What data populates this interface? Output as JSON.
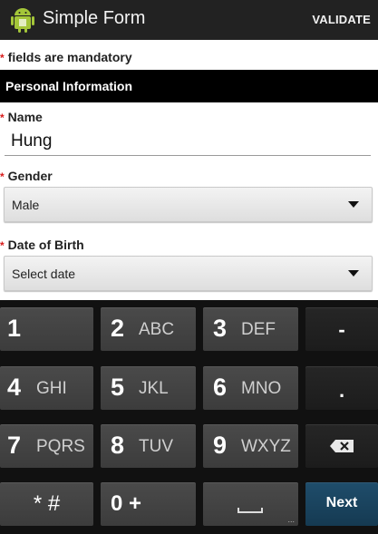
{
  "app": {
    "title": "Simple Form",
    "validate_label": "VALIDATE"
  },
  "form": {
    "mandatory_note": "fields are mandatory",
    "section_title": "Personal Information",
    "name": {
      "label": "Name",
      "value": "Hung"
    },
    "gender": {
      "label": "Gender",
      "selected": "Male"
    },
    "dob": {
      "label": "Date of Birth",
      "selected": "Select date"
    }
  },
  "keyboard": {
    "rows": [
      [
        {
          "num": "1",
          "letters": ""
        },
        {
          "num": "2",
          "letters": "ABC"
        },
        {
          "num": "3",
          "letters": "DEF"
        },
        {
          "label": "-"
        }
      ],
      [
        {
          "num": "4",
          "letters": "GHI"
        },
        {
          "num": "5",
          "letters": "JKL"
        },
        {
          "num": "6",
          "letters": "MNO"
        },
        {
          "label": "."
        }
      ],
      [
        {
          "num": "7",
          "letters": "PQRS"
        },
        {
          "num": "8",
          "letters": "TUV"
        },
        {
          "num": "9",
          "letters": "WXYZ"
        },
        {
          "label": "backspace-icon"
        }
      ],
      [
        {
          "label": "* #"
        },
        {
          "label": "0 +"
        },
        {
          "label": "space-icon"
        },
        {
          "label": "Next"
        }
      ]
    ],
    "space_dots": "..."
  },
  "colors": {
    "required_star": "#d81c1c",
    "next_key": "#1f4d6b"
  }
}
